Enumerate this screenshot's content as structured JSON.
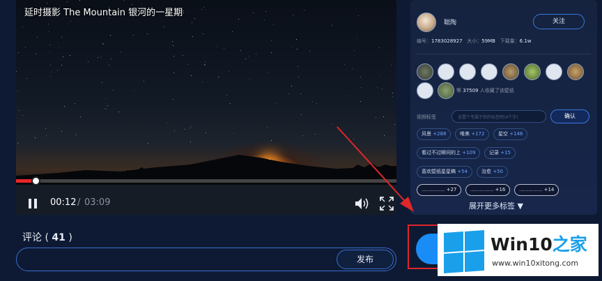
{
  "video": {
    "title": "延时摄影 The Mountain 银河的一星期",
    "progress": 0.052,
    "current_time": "00:12",
    "separator": "/",
    "total_time": "03:09"
  },
  "comments": {
    "label": "评论 (",
    "count": "41",
    "close": ")",
    "input_placeholder": "",
    "publish_label": "发布"
  },
  "uploader": {
    "name": "聪陶",
    "follow_label": "关注",
    "stats": {
      "id_label": "编号：",
      "id_value": "1783028927",
      "size_label": "大小：",
      "size_value": "59MB",
      "downloads_label": "下载量：",
      "downloads_value": "6.1w"
    }
  },
  "fans": {
    "count_prefix": "等",
    "count_value": "37509",
    "count_suffix": "人收藏了该壁纸"
  },
  "tags": {
    "label": "视频标签",
    "input_placeholder": "设置个专属于你的标签吧(4个字)",
    "confirm_label": "确认",
    "items": [
      {
        "name": "风景",
        "count": "+288"
      },
      {
        "name": "唯美",
        "count": "+172"
      },
      {
        "name": "星空",
        "count": "+146"
      },
      {
        "name": "看过不过瞬间的上",
        "count": "+109"
      },
      {
        "name": "记录",
        "count": "+15"
      },
      {
        "name": "喜欢壁纸星星稿",
        "count": "+54"
      },
      {
        "name": "治愈",
        "count": "+50"
      },
      {
        "name": "...............",
        "count": "+27"
      },
      {
        "name": "...............",
        "count": "+16"
      },
      {
        "name": "...............",
        "count": "+14"
      }
    ],
    "expand_label": "展开更多标签 ▼"
  },
  "watermark": {
    "brand_main": "Win10",
    "brand_accent": "之家",
    "url": "www.win10xitong.com"
  },
  "colors": {
    "accent": "#1a8cf5",
    "progress": "#e8262a",
    "annotation": "#e0262a",
    "windows_blue": "#1aa0ea"
  }
}
